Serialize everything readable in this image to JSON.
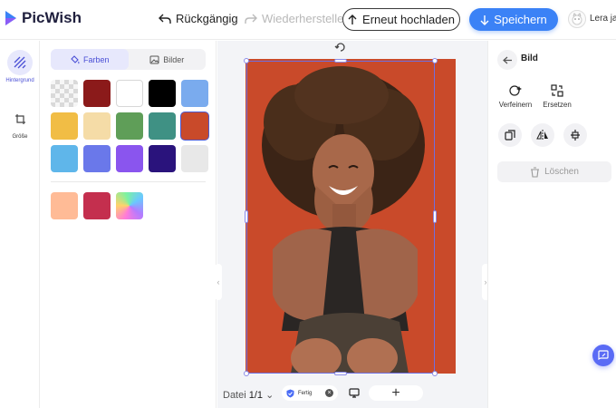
{
  "app": {
    "name": "PicWish",
    "brand_color": "#3b82f6",
    "accent_color": "#4a4fd6"
  },
  "toolbar": {
    "undo_label": "Rückgängig",
    "redo_label": "Wiederherstellen",
    "reupload_label": "Erneut hochladen",
    "save_label": "Speichern",
    "user_name": "Lera ja"
  },
  "rail": {
    "items": [
      {
        "label": "Hintergrund",
        "icon": "stripes-icon",
        "active": true
      },
      {
        "label": "Größe",
        "icon": "crop-icon",
        "active": false
      }
    ]
  },
  "panel": {
    "tabs": [
      {
        "label": "Farben",
        "icon": "paint-bucket-icon",
        "active": true
      },
      {
        "label": "Bilder",
        "icon": "image-icon",
        "active": false
      }
    ],
    "colors": [
      "transparent",
      "#8b1a1a",
      "#ffffff",
      "#000000",
      "#7aabee",
      "#f1bd45",
      "#f5dca7",
      "#5f9e58",
      "#3f9184",
      "#c94a2a",
      "#5fb6ea",
      "#6a78ea",
      "#8a55ee",
      "#2a137c",
      "#e8e8e8",
      "#ffbb96",
      "#c42f4e",
      "gradient"
    ],
    "selected_color": "#c94a2a"
  },
  "canvas": {
    "file_label": "Datei",
    "file_count": "1/1",
    "status_label": "Fertig",
    "background_color": "#c94a2a"
  },
  "right_panel": {
    "title": "Bild",
    "actions": [
      {
        "label": "Verfeinern",
        "icon": "refine-icon"
      },
      {
        "label": "Ersetzen",
        "icon": "replace-icon"
      }
    ],
    "tools": [
      "duplicate-icon",
      "flip-horizontal-icon",
      "align-center-icon"
    ],
    "delete_label": "Löschen"
  }
}
